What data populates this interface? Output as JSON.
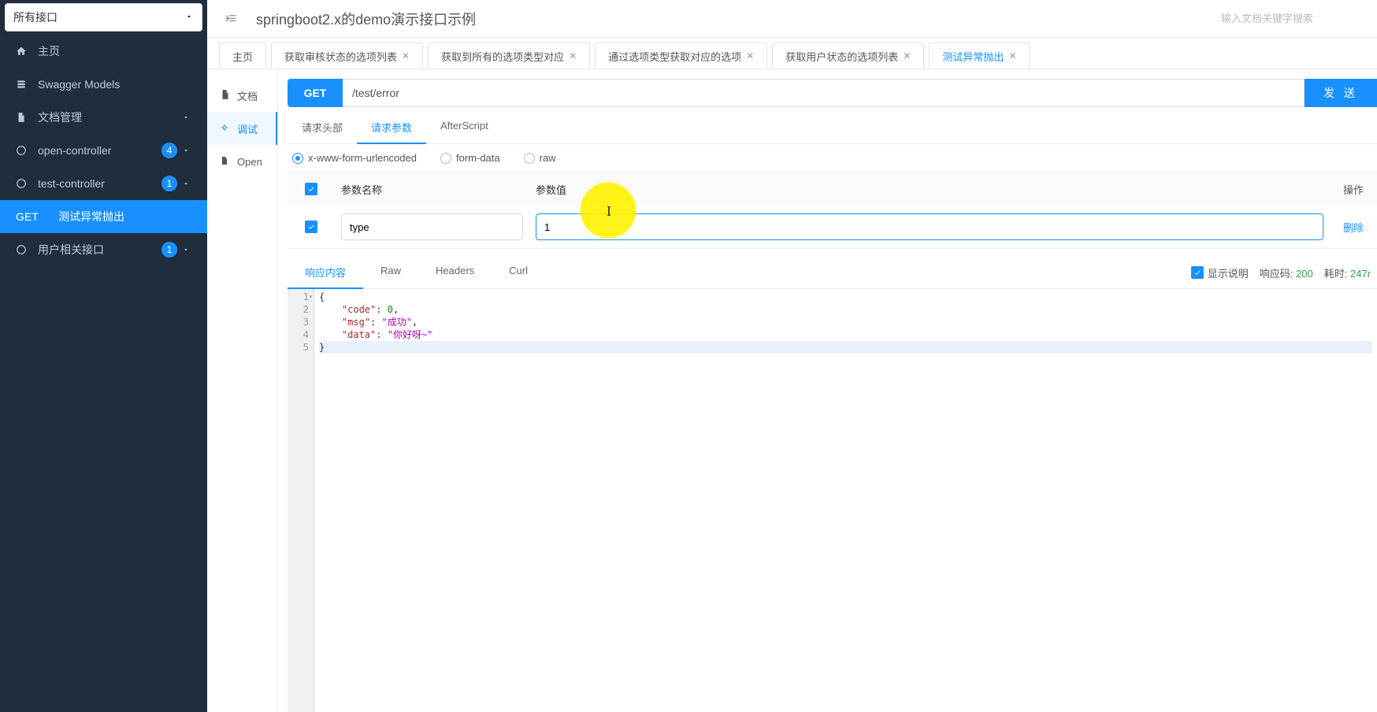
{
  "sidebar": {
    "selector": "所有接口",
    "items": [
      {
        "icon": "home",
        "label": "主页",
        "badge": null,
        "expandable": false
      },
      {
        "icon": "models",
        "label": "Swagger Models",
        "badge": null,
        "expandable": false
      },
      {
        "icon": "doc",
        "label": "文档管理",
        "badge": null,
        "expandable": true,
        "expanded": false
      },
      {
        "icon": "api",
        "label": "open-controller",
        "badge": "4",
        "expandable": true,
        "expanded": false
      },
      {
        "icon": "api",
        "label": "test-controller",
        "badge": "1",
        "expandable": true,
        "expanded": true
      },
      {
        "icon": "api",
        "label": "用户相关接口",
        "badge": "1",
        "expandable": true,
        "expanded": false
      }
    ],
    "subitem": {
      "method": "GET",
      "label": "测试异常抛出"
    }
  },
  "header": {
    "title": "springboot2.x的demo演示接口示例",
    "search_placeholder": "输入文档关键字搜索"
  },
  "tabs": [
    {
      "label": "主页",
      "closable": false,
      "active": false
    },
    {
      "label": "获取审核状态的选项列表",
      "closable": true,
      "active": false
    },
    {
      "label": "获取到所有的选项类型对应",
      "closable": true,
      "active": false
    },
    {
      "label": "通过选项类型获取对应的选项",
      "closable": true,
      "active": false
    },
    {
      "label": "获取用户状态的选项列表",
      "closable": true,
      "active": false
    },
    {
      "label": "测试异常抛出",
      "closable": true,
      "active": true
    }
  ],
  "leftnav": [
    {
      "icon": "doc",
      "label": "文档",
      "active": false
    },
    {
      "icon": "debug",
      "label": "调试",
      "active": true
    },
    {
      "icon": "open",
      "label": "Open",
      "active": false
    }
  ],
  "request": {
    "method": "GET",
    "url": "/test/error",
    "send_label": "发 送"
  },
  "subtabs": [
    {
      "label": "请求头部",
      "active": false
    },
    {
      "label": "请求参数",
      "active": true
    },
    {
      "label": "AfterScript",
      "active": false
    }
  ],
  "bodytypes": [
    {
      "label": "x-www-form-urlencoded",
      "checked": true
    },
    {
      "label": "form-data",
      "checked": false
    },
    {
      "label": "raw",
      "checked": false
    }
  ],
  "params_header": {
    "name": "参数名称",
    "value": "参数值",
    "action": "操作"
  },
  "params": [
    {
      "checked": true,
      "name": "type",
      "value": "1",
      "delete": "删除"
    }
  ],
  "resp_tabs": [
    {
      "label": "响应内容",
      "active": true
    },
    {
      "label": "Raw",
      "active": false
    },
    {
      "label": "Headers",
      "active": false
    },
    {
      "label": "Curl",
      "active": false
    }
  ],
  "resp_meta": {
    "show_desc_label": "显示说明",
    "code_label": "响应码:",
    "code_val": "200",
    "time_label": "耗时:",
    "time_val": "247r"
  },
  "response_json": {
    "lines": [
      "1",
      "2",
      "3",
      "4",
      "5"
    ],
    "l1_open": "{",
    "l2_key": "\"code\"",
    "l2_colon": ": ",
    "l2_val": "0",
    "l2_comma": ",",
    "l3_key": "\"msg\"",
    "l3_colon": ": ",
    "l3_val": "\"成功\"",
    "l3_comma": ",",
    "l4_key": "\"data\"",
    "l4_colon": ": ",
    "l4_val": "\"你好呀~\"",
    "l5_close": "}"
  }
}
